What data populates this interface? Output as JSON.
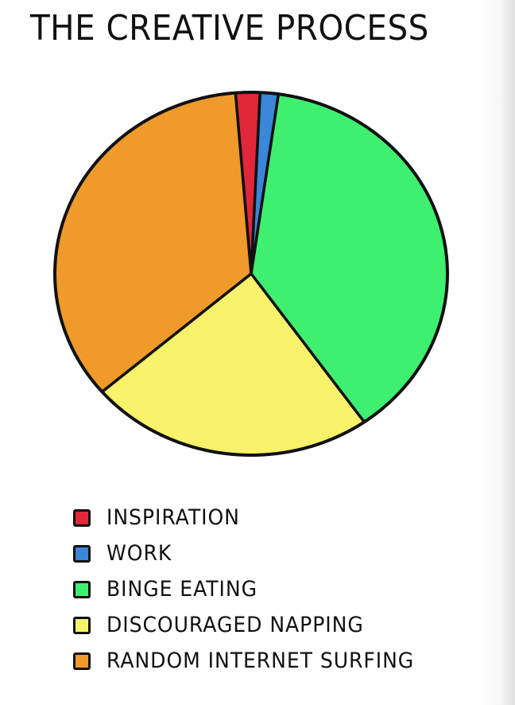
{
  "chart_data": {
    "type": "pie",
    "title": "THE CREATIVE PROCESS",
    "legend_placement": "bottom",
    "slices": [
      {
        "label": "INSPIRATION",
        "value": 2,
        "color": "#e0283a"
      },
      {
        "label": "WORK",
        "value": 1.5,
        "color": "#3a86d8"
      },
      {
        "label": "BINGE EATING",
        "value": 38,
        "color": "#3ff070"
      },
      {
        "label": "DISCOURAGED NAPPING",
        "value": 23.5,
        "color": "#f7f26a"
      },
      {
        "label": "RANDOM INTERNET SURFING",
        "value": 35,
        "color": "#ef9a2a"
      }
    ]
  }
}
